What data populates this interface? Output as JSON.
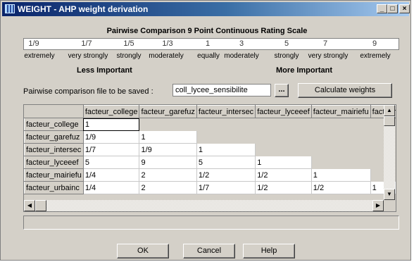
{
  "window": {
    "title": "WEIGHT - AHP weight derivation",
    "controls": {
      "minimize": "_",
      "restore": "□",
      "close": "×"
    }
  },
  "scale": {
    "title": "Pairwise Comparison 9 Point Continuous Rating Scale",
    "ticks": [
      "1/9",
      "1/7",
      "1/5",
      "1/3",
      "1",
      "3",
      "5",
      "7",
      "9"
    ],
    "labels": [
      "extremely",
      "very strongly",
      "strongly",
      "moderately",
      "equally",
      "moderately",
      "strongly",
      "very strongly",
      "extremely"
    ],
    "less_important": "Less Important",
    "more_important": "More Important"
  },
  "file": {
    "label": "Pairwise comparison file to be saved :",
    "value": "coll_lycee_sensibilite",
    "browse_label": "...",
    "calculate_label": "Calculate weights"
  },
  "matrix": {
    "columns": [
      "facteur_college",
      "facteur_garefuz",
      "facteur_intersec",
      "facteur_lyceeef",
      "facteur_mairiefu",
      "facteur_urbainc"
    ],
    "rows": [
      {
        "label": "facteur_college",
        "cells": [
          "1",
          "",
          "",
          "",
          "",
          ""
        ]
      },
      {
        "label": "facteur_garefuz",
        "cells": [
          "1/9",
          "1",
          "",
          "",
          "",
          ""
        ]
      },
      {
        "label": "facteur_intersec",
        "cells": [
          "1/7",
          "1/9",
          "1",
          "",
          "",
          ""
        ]
      },
      {
        "label": "facteur_lyceeef",
        "cells": [
          "5",
          "9",
          "5",
          "1",
          "",
          ""
        ]
      },
      {
        "label": "facteur_mairiefu",
        "cells": [
          "1/4",
          "2",
          "1/2",
          "1/2",
          "1",
          ""
        ]
      },
      {
        "label": "facteur_urbainc",
        "cells": [
          "1/4",
          "2",
          "1/7",
          "1/2",
          "1/2",
          "1"
        ]
      }
    ]
  },
  "buttons": {
    "ok": "OK",
    "cancel": "Cancel",
    "help": "Help"
  },
  "icons": {
    "app": "grid-app-icon",
    "scroll_up": "arrow-up-icon",
    "scroll_down": "arrow-down-icon",
    "scroll_left": "arrow-left-icon",
    "scroll_right": "arrow-right-icon"
  }
}
